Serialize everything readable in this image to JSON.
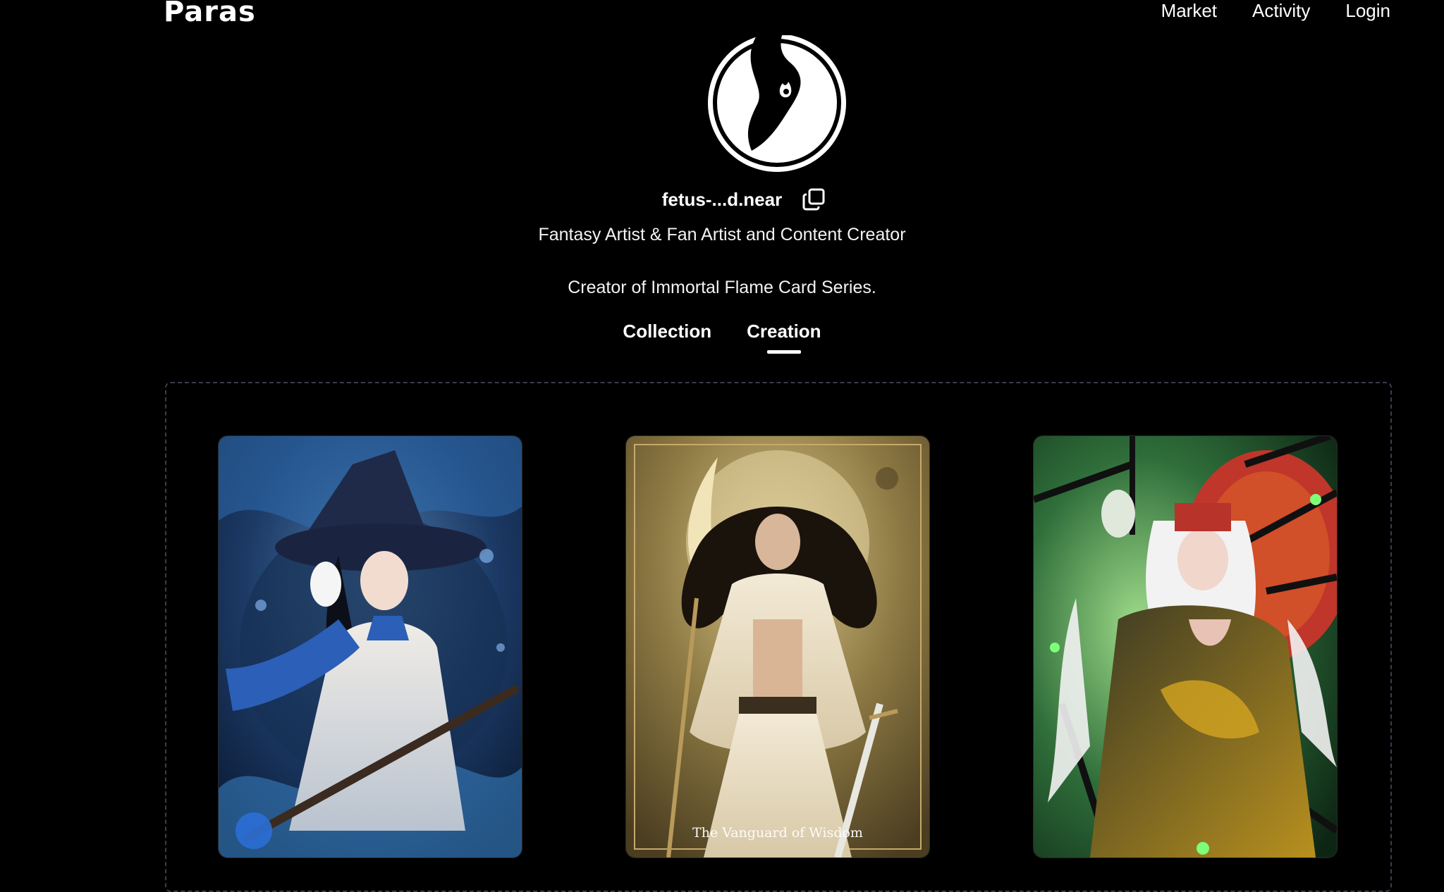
{
  "header": {
    "logo_text": "Paras",
    "nav": [
      {
        "label": "Market"
      },
      {
        "label": "Activity"
      },
      {
        "label": "Login"
      }
    ]
  },
  "profile": {
    "username": "fetus-...d.near",
    "bio_line1": "Fantasy Artist & Fan Artist and Content Creator",
    "bio_line2": "Creator of Immortal Flame Card Series."
  },
  "tabs": [
    {
      "label": "Collection",
      "active": false
    },
    {
      "label": "Creation",
      "active": true
    }
  ],
  "cards": [
    {
      "caption": ""
    },
    {
      "caption": "The Vanguard of Wisdom"
    },
    {
      "caption": ""
    }
  ],
  "icons": {
    "copy": "copy-icon",
    "avatar": "avatar-logo"
  },
  "colors": {
    "background": "#000000",
    "text": "#ffffff",
    "frame_border": "#3c3c4e"
  }
}
